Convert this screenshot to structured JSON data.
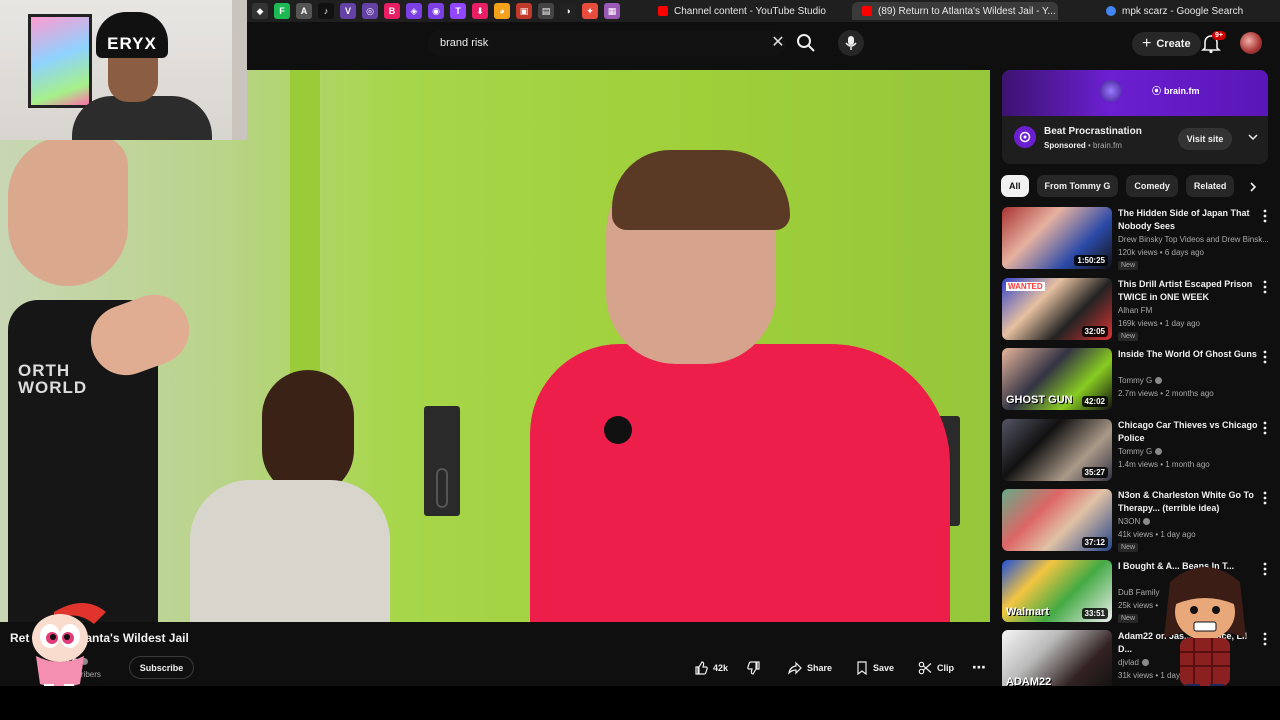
{
  "browser": {
    "tabs": [
      {
        "label": "Channel content - YouTube Studio",
        "active": false,
        "color": "#ff0000"
      },
      {
        "label": "(89) Return to Atlanta's Wildest Jail - Y...",
        "active": true,
        "color": "#ff0000"
      },
      {
        "label": "mpk scarz - Google Search",
        "active": false,
        "color": "#4285f4"
      }
    ],
    "pinned": [
      {
        "glyph": "◆",
        "color": "#333"
      },
      {
        "glyph": "F",
        "color": "#1db954"
      },
      {
        "glyph": "A",
        "color": "#555"
      },
      {
        "glyph": "♪",
        "color": "#111"
      },
      {
        "glyph": "V",
        "color": "#6441a5"
      },
      {
        "glyph": "◎",
        "color": "#6441a5"
      },
      {
        "glyph": "B",
        "color": "#e91e63"
      },
      {
        "glyph": "◈",
        "color": "#7b3fe4"
      },
      {
        "glyph": "◉",
        "color": "#7b3fe4"
      },
      {
        "glyph": "T",
        "color": "#9146ff"
      },
      {
        "glyph": "⬇",
        "color": "#e91e63"
      },
      {
        "glyph": "◕",
        "color": "#f4a21b"
      },
      {
        "glyph": "▣",
        "color": "#c0392b"
      },
      {
        "glyph": "▤",
        "color": "#444"
      },
      {
        "glyph": "◑",
        "color": "#222"
      },
      {
        "glyph": "✦",
        "color": "#e74c3c"
      },
      {
        "glyph": "▦",
        "color": "#9b59b6"
      }
    ]
  },
  "header": {
    "search_query": "brand risk",
    "create_label": "Create",
    "notifications_badge": "9+"
  },
  "webcam": {
    "beanie_text": "ERYX"
  },
  "player": {
    "shirt_logo": "ORTH\nWORLD"
  },
  "video": {
    "title_visible": "Ret",
    "title_rest": "anta's Wildest Jail",
    "channel": "y G",
    "subs": "subscribers",
    "subscribe_label": "Subscribe",
    "likes": "42k",
    "share_label": "Share",
    "save_label": "Save",
    "clip_label": "Clip"
  },
  "ad": {
    "brand": "brain.fm",
    "title": "Beat Procrastination",
    "sponsored": "Sponsored",
    "domain": "brain.fm",
    "visit_label": "Visit site"
  },
  "chips": [
    "All",
    "From Tommy G",
    "Comedy",
    "Related"
  ],
  "recommendations": [
    {
      "title": "The Hidden Side of Japan That Nobody Sees",
      "channel": "Drew Binsky Top Videos and Drew Binsk...",
      "verified": false,
      "meta": "120k views • 6 days ago",
      "new": "New",
      "duration": "1:50:25",
      "caption": ""
    },
    {
      "title": "This Drill Artist Escaped Prison TWICE in ONE WEEK",
      "channel": "Alhan FM",
      "verified": false,
      "meta": "169k views • 1 day ago",
      "new": "New",
      "duration": "32:05",
      "caption": "WANTED"
    },
    {
      "title": "Inside The World Of Ghost Guns",
      "channel": "Tommy G",
      "verified": true,
      "meta": "2.7m views • 2 months ago",
      "new": "",
      "duration": "42:02",
      "caption": "GHOST GUN"
    },
    {
      "title": "Chicago Car Thieves vs Chicago Police",
      "channel": "Tommy G",
      "verified": true,
      "meta": "1.4m views • 1 month ago",
      "new": "",
      "duration": "35:27",
      "caption": ""
    },
    {
      "title": "N3on & Charleston White Go To Therapy... (terrible idea)",
      "channel": "N3ON",
      "verified": true,
      "meta": "41k views • 1 day ago",
      "new": "New",
      "duration": "37:12",
      "caption": ""
    },
    {
      "title": "I Bought & A... Beans In T...",
      "channel": "DuB Family",
      "verified": false,
      "meta": "25k views •",
      "new": "New",
      "duration": "33:51",
      "caption": "Walmart"
    },
    {
      "title": "Adam22 on Jas... Blueface, Lil D...",
      "channel": "djvlad",
      "verified": true,
      "meta": "31k views • 1 day ago",
      "new": "",
      "duration": "",
      "caption": "ADAM22"
    }
  ]
}
